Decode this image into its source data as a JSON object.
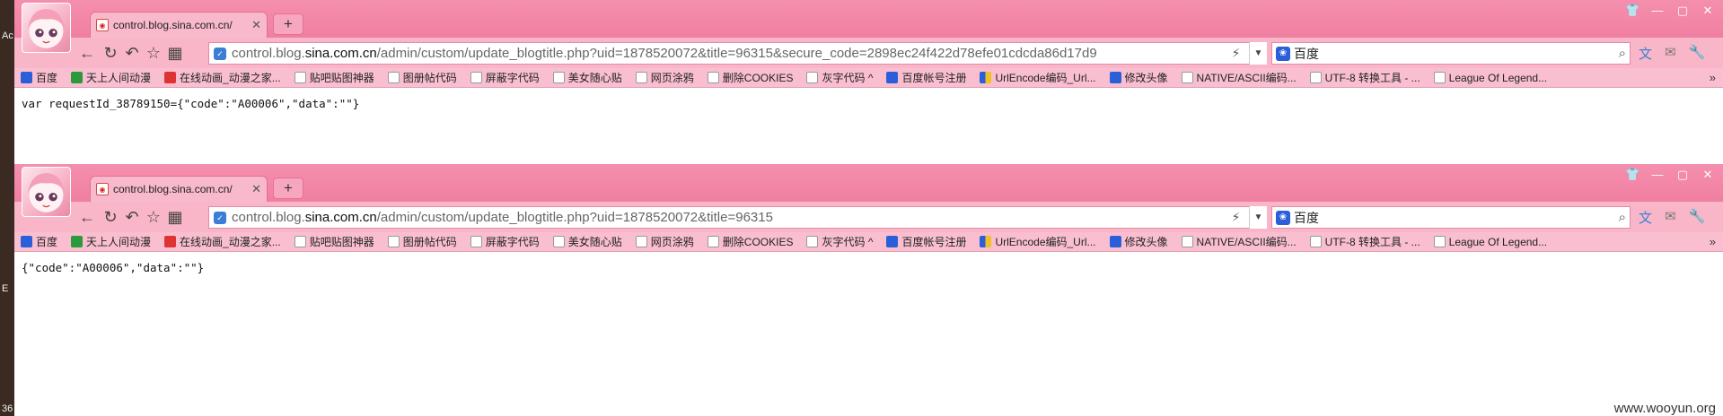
{
  "desktop": {
    "side_text_top": "Ac",
    "side_text_mid": "E",
    "side_text_bottom": "36"
  },
  "browsers": [
    {
      "tab_title": "control.blog.sina.com.cn/",
      "url_prefix": "control.blog.",
      "url_domain": "sina.com.cn",
      "url_rest": "/admin/custom/update_blogtitle.php?uid=1878520072&title=96315&secure_code=2898ec24f422d78efe01cdcda86d17d9",
      "search_text": "百度",
      "content": "var requestId_38789150={\"code\":\"A00006\",\"data\":\"\"}"
    },
    {
      "tab_title": "control.blog.sina.com.cn/",
      "url_prefix": "control.blog.",
      "url_domain": "sina.com.cn",
      "url_rest": "/admin/custom/update_blogtitle.php?uid=1878520072&title=96315",
      "search_text": "百度",
      "content": "{\"code\":\"A00006\",\"data\":\"\"}"
    }
  ],
  "bookmarks": [
    {
      "label": "百度",
      "icon": "paw-icon"
    },
    {
      "label": "天上人间动漫",
      "icon": "green-icon"
    },
    {
      "label": "在线动画_动漫之家...",
      "icon": "red-icon"
    },
    {
      "label": "贴吧贴图神器",
      "icon": "folder-icon"
    },
    {
      "label": "图册帖代码",
      "icon": "folder-icon"
    },
    {
      "label": "屏蔽字代码",
      "icon": "folder-icon"
    },
    {
      "label": "美女随心贴",
      "icon": "folder-icon"
    },
    {
      "label": "网页涂鸦",
      "icon": "folder-icon"
    },
    {
      "label": "删除COOKIES",
      "icon": "folder-icon"
    },
    {
      "label": "灰字代码 ^",
      "icon": "folder-icon"
    },
    {
      "label": "百度帐号注册",
      "icon": "paw-icon"
    },
    {
      "label": "UrlEncode编码_Url...",
      "icon": "tool-icon"
    },
    {
      "label": "修改头像",
      "icon": "paw-icon"
    },
    {
      "label": "NATIVE/ASCII编码...",
      "icon": "folder-icon"
    },
    {
      "label": "UTF-8 转换工具 - ...",
      "icon": "folder-icon"
    },
    {
      "label": "League Of Legend...",
      "icon": "folder-icon"
    }
  ],
  "bookmarks_more": "»",
  "watermark": "www.wooyun.org",
  "colors": {
    "titlebar": "#f07fa1",
    "toolbar": "#f9b6c9",
    "bookmarks_bar": "#f9bfd0"
  }
}
